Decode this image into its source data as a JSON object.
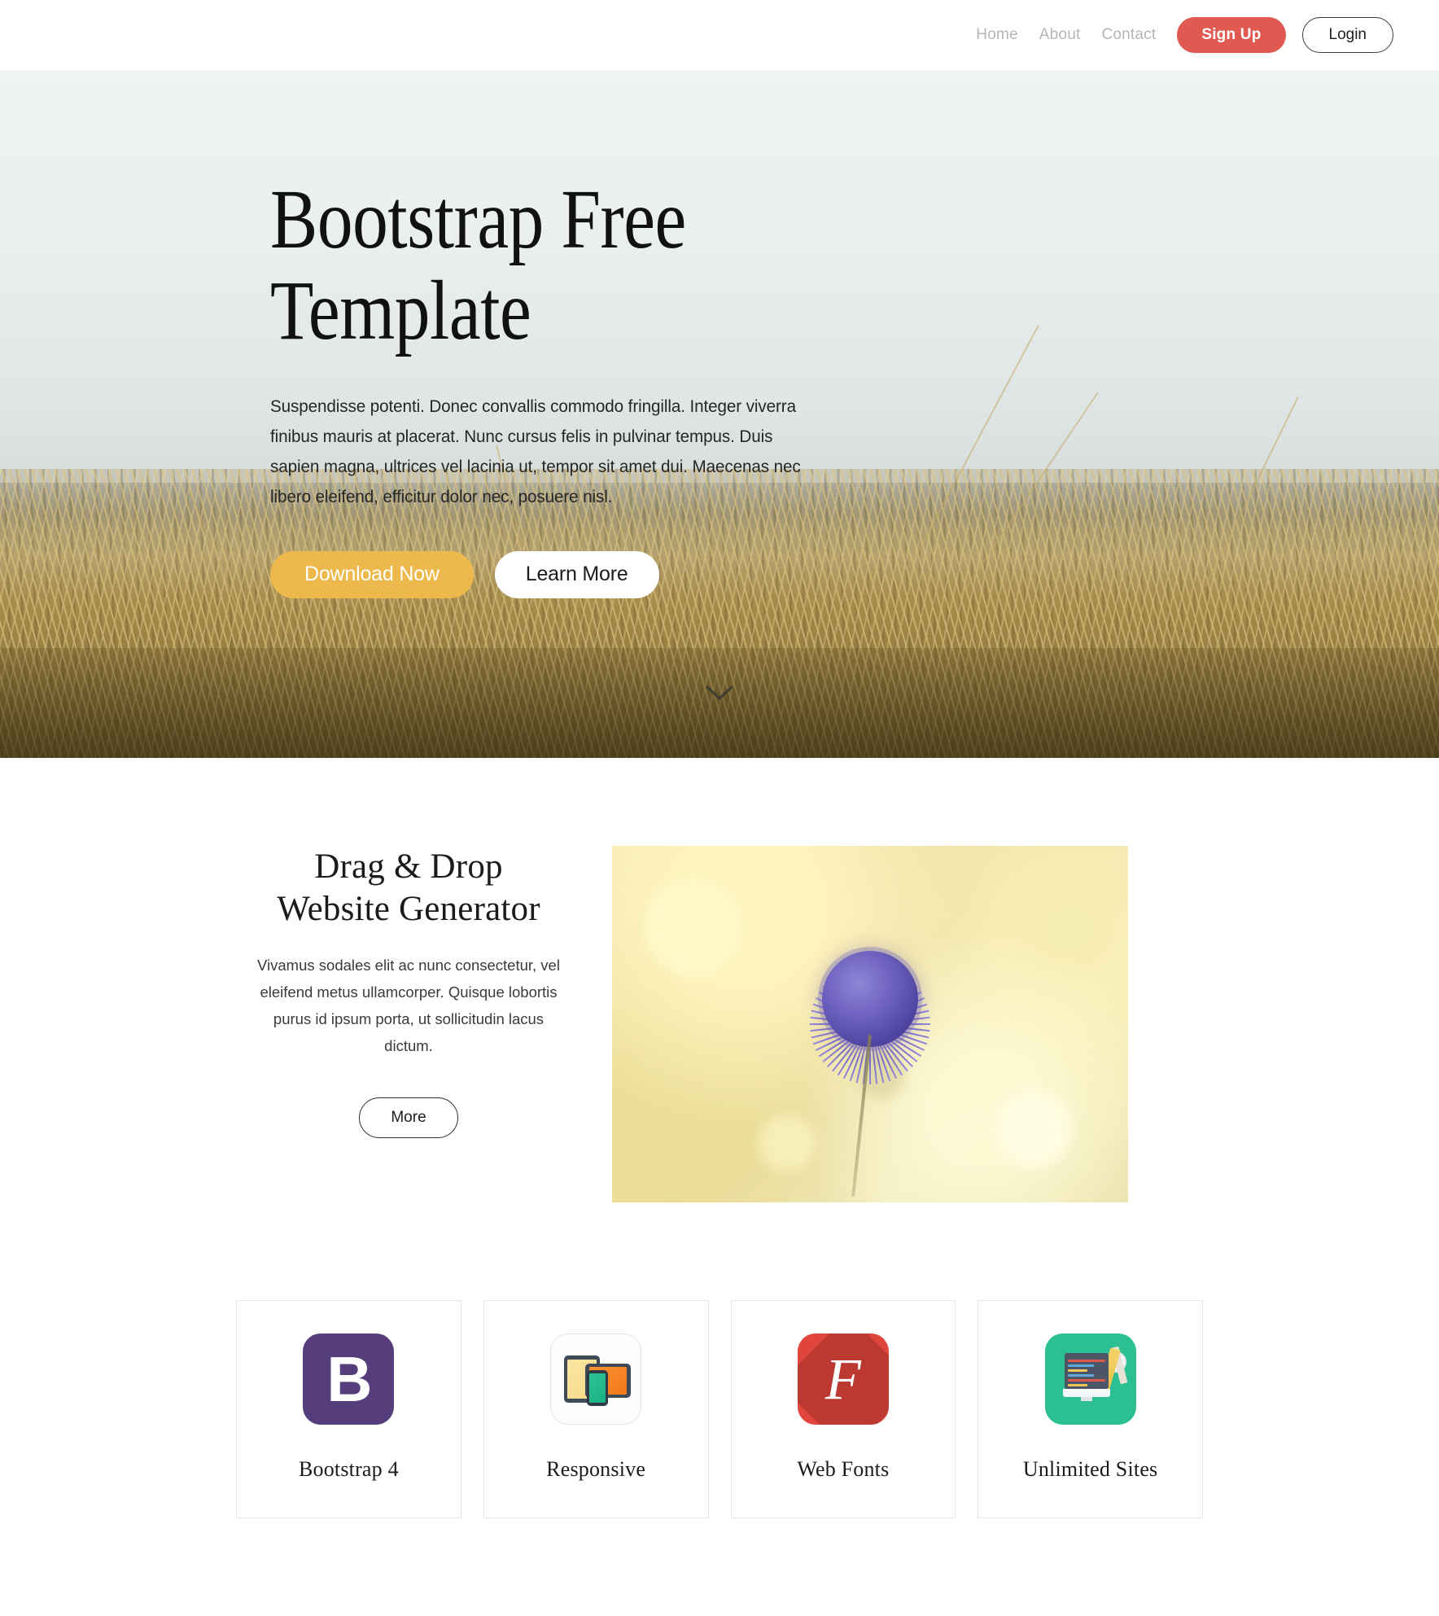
{
  "navbar": {
    "links": [
      {
        "label": "Home",
        "name": "nav-link-home"
      },
      {
        "label": "About",
        "name": "nav-link-about"
      },
      {
        "label": "Contact",
        "name": "nav-link-contact"
      }
    ],
    "signup_label": "Sign Up",
    "login_label": "Login",
    "signup_color": "#e05a52"
  },
  "hero": {
    "title": "Bootstrap Free\nTemplate",
    "paragraph": "Suspendisse potenti. Donec convallis commodo fringilla. Integer viverra finibus mauris at placerat. Nunc cursus felis in pulvinar tempus. Duis sapien magna, ultrices vel lacinia ut, tempor sit amet dui. Maecenas nec libero eleifend, efficitur dolor nec, posuere nisl.",
    "download_label": "Download Now",
    "learn_label": "Learn More",
    "download_color": "#edb94c",
    "scroll_icon": "chevron-down-icon"
  },
  "feature": {
    "title": "Drag & Drop\nWebsite Generator",
    "text": "Vivamus sodales elit ac nunc consectetur, vel eleifend metus ullamcorper. Quisque lobortis purus id ipsum porta, ut sollicitudin lacus dictum.",
    "more_label": "More",
    "image_alt": "purple thistle flower photo"
  },
  "cards": [
    {
      "label": "Bootstrap 4",
      "icon": "bootstrap-icon",
      "color": "#563d7c",
      "glyph": "B"
    },
    {
      "label": "Responsive",
      "icon": "devices-icon",
      "color": "#fdfdfd",
      "glyph": ""
    },
    {
      "label": "Web Fonts",
      "icon": "font-awesome-icon",
      "color": "#e0453c",
      "glyph": "F"
    },
    {
      "label": "Unlimited Sites",
      "icon": "workstation-icon",
      "color": "#2bbf91",
      "glyph": ""
    }
  ]
}
